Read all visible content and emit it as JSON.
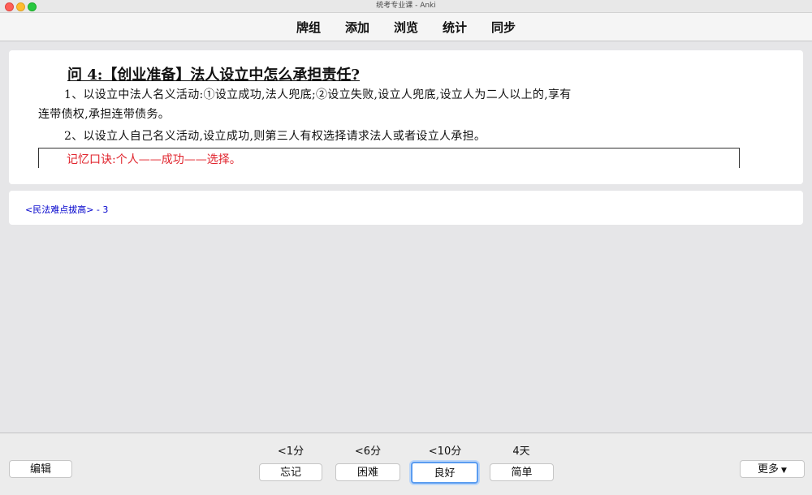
{
  "window": {
    "title": "统考专业课 - Anki"
  },
  "topmenu": {
    "items": [
      "牌组",
      "添加",
      "浏览",
      "统计",
      "同步"
    ]
  },
  "question": {
    "title": "问 4:【创业准备】法人设立中怎么承担责任?",
    "line1": "1、以设立中法人名义活动:①设立成功,法人兜底;②设立失败,设立人兜底,设立人为二人以上的,享有",
    "line2": "连带债权,承担连带债务。",
    "line3": "2、以设立人自己名义活动,设立成功,则第三人有权选择请求法人或者设立人承担。",
    "memo": "记忆口诀:个人——成功——选择。"
  },
  "tag": {
    "deck": "<民法难点拔高>",
    "suffix": " - 3"
  },
  "bottom": {
    "edit_label": "编辑",
    "more_label": "更多",
    "intervals": {
      "again": "<1分",
      "hard": "<6分",
      "good": "<10分",
      "easy": "4天"
    },
    "answers": {
      "again": "忘记",
      "hard": "困难",
      "good": "良好",
      "easy": "简单"
    }
  },
  "colors": {
    "memo": "#e0242d",
    "tag_link": "#0000cc",
    "focus_ring": "#5a9cf0"
  }
}
